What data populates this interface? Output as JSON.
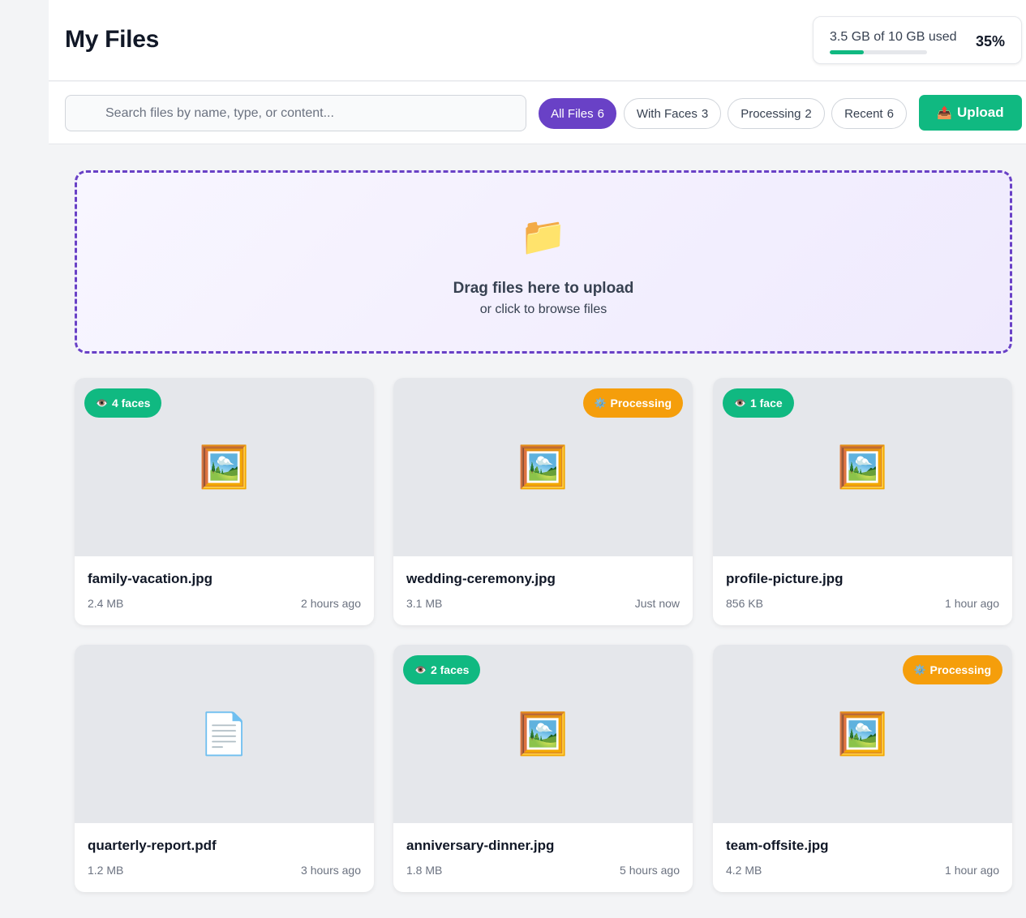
{
  "header": {
    "title": "My Files",
    "storage": {
      "text": "3.5 GB of 10 GB used",
      "percent_label": "35%",
      "used_fraction": 0.35,
      "color": "#10b981"
    }
  },
  "toolbar": {
    "search_placeholder": "Search files by name, type, or content...",
    "filters": [
      {
        "label": "All Files",
        "count": "6",
        "active": true
      },
      {
        "label": "With Faces",
        "count": "3",
        "active": false
      },
      {
        "label": "Processing",
        "count": "2",
        "active": false
      },
      {
        "label": "Recent",
        "count": "6",
        "active": false
      }
    ],
    "upload_icon": "📤",
    "upload_label": "Upload"
  },
  "dropzone": {
    "icon": "📁",
    "title": "Drag files here to upload",
    "subtitle": "or click to browse files"
  },
  "files": [
    {
      "name": "family-vacation.jpg",
      "size": "2.4 MB",
      "time": "2 hours ago",
      "icon": "🖼️",
      "badge": {
        "type": "faces",
        "icon": "👁️",
        "label": "4 faces"
      }
    },
    {
      "name": "wedding-ceremony.jpg",
      "size": "3.1 MB",
      "time": "Just now",
      "icon": "🖼️",
      "badge": {
        "type": "processing",
        "icon": "⚙️",
        "label": "Processing"
      }
    },
    {
      "name": "profile-picture.jpg",
      "size": "856 KB",
      "time": "1 hour ago",
      "icon": "🖼️",
      "badge": {
        "type": "faces",
        "icon": "👁️",
        "label": "1 face"
      }
    },
    {
      "name": "quarterly-report.pdf",
      "size": "1.2 MB",
      "time": "3 hours ago",
      "icon": "📄",
      "badge": null
    },
    {
      "name": "anniversary-dinner.jpg",
      "size": "1.8 MB",
      "time": "5 hours ago",
      "icon": "🖼️",
      "badge": {
        "type": "faces",
        "icon": "👁️",
        "label": "2 faces"
      }
    },
    {
      "name": "team-offsite.jpg",
      "size": "4.2 MB",
      "time": "1 hour ago",
      "icon": "🖼️",
      "badge": {
        "type": "processing",
        "icon": "⚙️",
        "label": "Processing"
      }
    }
  ],
  "colors": {
    "accent": "#6941c6",
    "success": "#10b981",
    "warning": "#f59e0b"
  }
}
